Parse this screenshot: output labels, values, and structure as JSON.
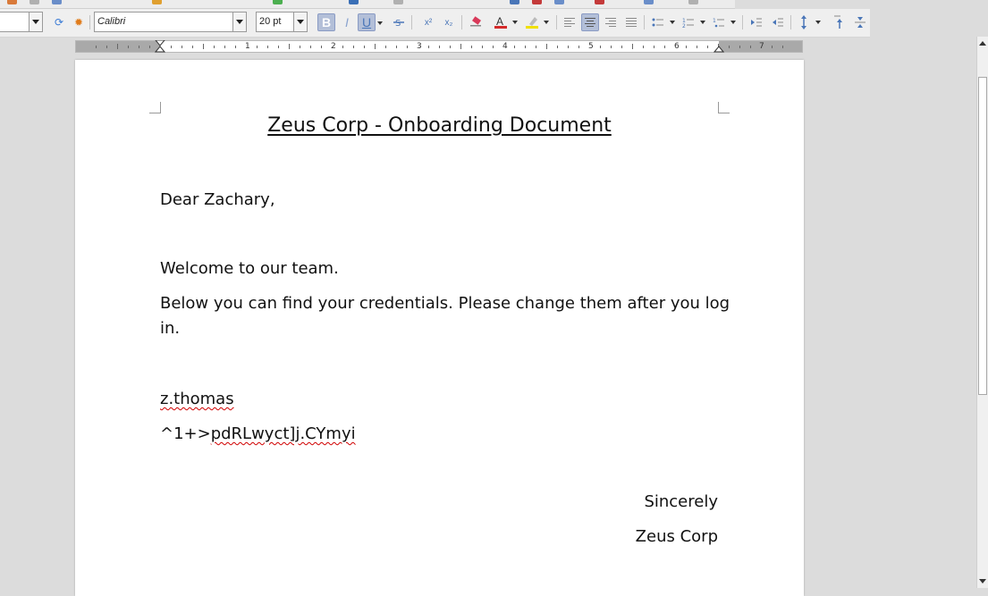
{
  "toolbar": {
    "paragraph_style": "",
    "font_name": "Calibri",
    "font_size": "20 pt",
    "bold_label": "B",
    "italic_label": "I",
    "underline_label": "U",
    "superscript_label": "x²",
    "subscript_label": "x₂",
    "ruler_numbers": [
      "1",
      "2",
      "3",
      "4",
      "5",
      "6",
      "7"
    ]
  },
  "document": {
    "title": "Zeus Corp - Onboarding Document",
    "greeting": "Dear Zachary,",
    "welcome": "Welcome to our team.",
    "instructions_line1": "Below you can find your credentials. Please change them after you log",
    "instructions_line2": "in.",
    "username": "z.thomas",
    "password": "^1+>pdRLwyct]j.CYmyi",
    "closing": "Sincerely",
    "signature": "Zeus Corp"
  },
  "colors": {
    "font_color": "#d42a2a",
    "highlight_color": "#f0e000",
    "spellcheck": "#d00000",
    "active_button": "#b3bfd8"
  }
}
